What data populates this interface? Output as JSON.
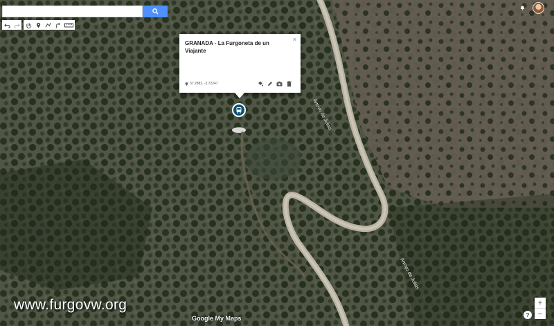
{
  "search": {
    "placeholder": "",
    "value": ""
  },
  "toolbar": {
    "undo": "undo-icon",
    "redo": "redo-icon",
    "pan": "hand-icon",
    "add_marker": "marker-icon",
    "draw_line": "line-icon",
    "directions": "directions-icon",
    "measure": "ruler-icon"
  },
  "popup": {
    "title": "GRANADA - La Furgoneta de un Viajante",
    "coords": "37.2882, -2.72247",
    "close": "×",
    "actions": [
      "paint-icon",
      "edit-icon",
      "camera-icon",
      "delete-icon"
    ]
  },
  "map": {
    "road_labels": [
      "Arroyo de Julias",
      "Arroyo de Julias"
    ]
  },
  "watermark": "www.furgovw.org",
  "logo": "Google My Maps",
  "zoom": {
    "in": "+",
    "out": "−"
  },
  "help": "?",
  "colors": {
    "accent": "#4d90fe",
    "marker": "#0a5272",
    "terrain": "#2f3a25",
    "road": "#b9b3a3"
  }
}
